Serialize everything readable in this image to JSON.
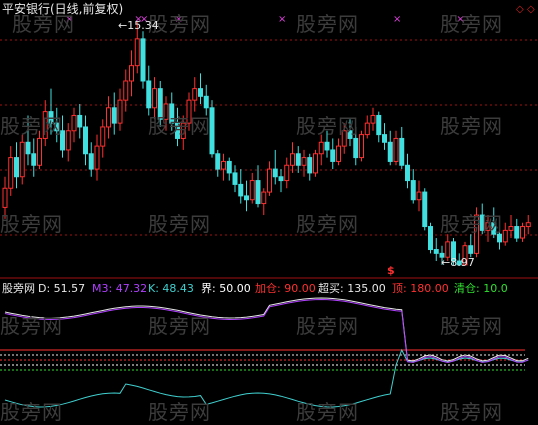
{
  "upper_panel": {
    "title": "平安银行(日线,前复权)",
    "high_label": "15.34",
    "low_label": "8.97",
    "signal_glyph": "$",
    "marker_glyph": "×"
  },
  "lower_panel": {
    "name": "股旁网",
    "readouts": [
      {
        "label": "D:",
        "value": "51.57",
        "color": "#e8e8e8"
      },
      {
        "label": "M3:",
        "value": "47.32",
        "color": "#b040ff"
      },
      {
        "label": "K:",
        "value": "48.43",
        "color": "#40d0d0"
      },
      {
        "label": "界:",
        "value": "50.00",
        "color": "#ffffff"
      },
      {
        "label": "加仓:",
        "value": "90.00",
        "color": "#ff3030"
      },
      {
        "label": "超买:",
        "value": "135.00",
        "color": "#e8e8e8"
      },
      {
        "label": "顶:",
        "value": "180.00",
        "color": "#ff3030"
      },
      {
        "label": "清仓:",
        "value": "10.0",
        "color": "#30e030"
      }
    ]
  },
  "watermark": "股旁网",
  "window_controls": {
    "first": "◇",
    "second": "◇"
  },
  "colors": {
    "up": "#ff3030",
    "down": "#40e0e0",
    "grid": "#a01010",
    "marker": "#e040e0",
    "d_line": "#e8e8e8",
    "m3_line": "#b040ff",
    "k_line": "#40d0d0"
  },
  "chart_data": {
    "type": "candlestick",
    "price_high": 15.34,
    "price_low": 8.97,
    "ohlc": [
      [
        10.5,
        11.3,
        10.2,
        11.0
      ],
      [
        11.0,
        12.1,
        10.8,
        11.8
      ],
      [
        11.8,
        12.2,
        11.0,
        11.3
      ],
      [
        11.3,
        12.4,
        11.1,
        12.2
      ],
      [
        12.2,
        12.9,
        11.6,
        11.9
      ],
      [
        11.9,
        12.3,
        11.3,
        11.6
      ],
      [
        11.6,
        12.5,
        11.5,
        12.3
      ],
      [
        12.3,
        13.3,
        12.1,
        13.0
      ],
      [
        13.0,
        13.6,
        12.4,
        12.7
      ],
      [
        12.7,
        13.1,
        12.2,
        12.5
      ],
      [
        12.5,
        12.9,
        11.8,
        12.0
      ],
      [
        12.0,
        12.7,
        11.7,
        12.5
      ],
      [
        12.5,
        13.1,
        12.2,
        12.9
      ],
      [
        12.9,
        13.2,
        12.3,
        12.6
      ],
      [
        12.6,
        12.9,
        11.6,
        11.9
      ],
      [
        11.9,
        12.2,
        11.3,
        11.5
      ],
      [
        11.5,
        12.4,
        11.2,
        12.1
      ],
      [
        12.1,
        12.8,
        11.8,
        12.6
      ],
      [
        12.6,
        13.4,
        12.3,
        13.1
      ],
      [
        13.1,
        13.5,
        12.4,
        12.7
      ],
      [
        12.7,
        13.6,
        12.5,
        13.3
      ],
      [
        13.3,
        14.1,
        13.0,
        13.8
      ],
      [
        13.8,
        14.6,
        13.4,
        14.2
      ],
      [
        14.2,
        15.34,
        14.0,
        14.9
      ],
      [
        14.9,
        15.1,
        13.6,
        13.8
      ],
      [
        13.8,
        14.2,
        12.9,
        13.1
      ],
      [
        13.1,
        13.9,
        12.8,
        13.6
      ],
      [
        13.6,
        13.8,
        12.6,
        12.8
      ],
      [
        12.8,
        13.4,
        12.5,
        13.2
      ],
      [
        13.2,
        13.5,
        12.5,
        12.7
      ],
      [
        12.7,
        13.1,
        12.1,
        12.3
      ],
      [
        12.3,
        12.9,
        12.0,
        12.7
      ],
      [
        12.7,
        13.5,
        12.5,
        13.3
      ],
      [
        13.3,
        13.9,
        13.0,
        13.6
      ],
      [
        13.6,
        14.0,
        13.2,
        13.4
      ],
      [
        13.4,
        13.7,
        12.9,
        13.1
      ],
      [
        13.1,
        13.3,
        11.8,
        11.9
      ],
      [
        11.9,
        12.0,
        11.3,
        11.5
      ],
      [
        11.5,
        11.9,
        11.2,
        11.7
      ],
      [
        11.7,
        11.8,
        11.2,
        11.4
      ],
      [
        11.4,
        11.6,
        10.9,
        11.1
      ],
      [
        11.1,
        11.5,
        10.6,
        10.8
      ],
      [
        10.8,
        11.2,
        10.4,
        10.7
      ],
      [
        10.7,
        11.4,
        10.6,
        11.2
      ],
      [
        11.2,
        11.6,
        10.5,
        10.6
      ],
      [
        10.6,
        11.0,
        10.3,
        10.9
      ],
      [
        10.9,
        11.7,
        10.8,
        11.5
      ],
      [
        11.5,
        12.0,
        11.1,
        11.3
      ],
      [
        11.3,
        11.5,
        10.9,
        11.2
      ],
      [
        11.2,
        11.8,
        11.0,
        11.6
      ],
      [
        11.6,
        12.2,
        11.4,
        11.9
      ],
      [
        11.9,
        12.1,
        11.4,
        11.6
      ],
      [
        11.6,
        12.0,
        11.3,
        11.8
      ],
      [
        11.8,
        11.9,
        11.2,
        11.4
      ],
      [
        11.4,
        12.0,
        11.3,
        11.9
      ],
      [
        11.9,
        12.4,
        11.6,
        12.2
      ],
      [
        12.2,
        12.5,
        11.8,
        12.0
      ],
      [
        12.0,
        12.3,
        11.5,
        11.7
      ],
      [
        11.7,
        12.3,
        11.6,
        12.1
      ],
      [
        12.1,
        12.7,
        11.9,
        12.5
      ],
      [
        12.5,
        12.8,
        12.1,
        12.3
      ],
      [
        12.3,
        12.6,
        11.6,
        11.8
      ],
      [
        11.8,
        12.5,
        11.7,
        12.4
      ],
      [
        12.4,
        12.9,
        12.3,
        12.7
      ],
      [
        12.7,
        13.1,
        12.5,
        12.9
      ],
      [
        12.9,
        13.0,
        12.2,
        12.4
      ],
      [
        12.4,
        12.7,
        12.0,
        12.2
      ],
      [
        12.2,
        12.5,
        11.6,
        11.7
      ],
      [
        11.7,
        12.5,
        11.6,
        12.3
      ],
      [
        12.3,
        12.6,
        11.5,
        11.6
      ],
      [
        11.6,
        11.9,
        11.0,
        11.2
      ],
      [
        11.2,
        11.5,
        10.6,
        10.7
      ],
      [
        10.7,
        11.2,
        10.4,
        10.9
      ],
      [
        10.9,
        11.0,
        9.9,
        10.0
      ],
      [
        10.0,
        10.1,
        9.3,
        9.4
      ],
      [
        9.4,
        9.7,
        9.1,
        9.3
      ],
      [
        9.3,
        9.5,
        9.0,
        9.2
      ],
      [
        9.2,
        9.8,
        9.1,
        9.6
      ],
      [
        9.6,
        9.7,
        9.0,
        9.1
      ],
      [
        9.1,
        9.3,
        8.97,
        9.0
      ],
      [
        9.0,
        9.6,
        8.98,
        9.5
      ],
      [
        9.5,
        9.8,
        9.2,
        9.3
      ],
      [
        9.3,
        10.5,
        9.2,
        10.3
      ],
      [
        10.3,
        10.6,
        9.8,
        9.9
      ],
      [
        9.9,
        10.3,
        9.6,
        10.1
      ],
      [
        10.1,
        10.5,
        9.7,
        9.8
      ],
      [
        9.8,
        10.0,
        9.4,
        9.6
      ],
      [
        9.6,
        10.1,
        9.5,
        9.9
      ],
      [
        9.9,
        10.3,
        9.7,
        10.0
      ],
      [
        10.0,
        10.2,
        9.6,
        9.7
      ],
      [
        9.7,
        10.1,
        9.6,
        10.0
      ],
      [
        10.0,
        10.3,
        9.8,
        10.1
      ]
    ],
    "indicator": {
      "lines": [
        "D",
        "M3",
        "K"
      ],
      "reference_levels": [
        10,
        50,
        90,
        135,
        180
      ],
      "last_values": {
        "D": 51.57,
        "M3": 47.32,
        "K": 48.43
      }
    }
  }
}
